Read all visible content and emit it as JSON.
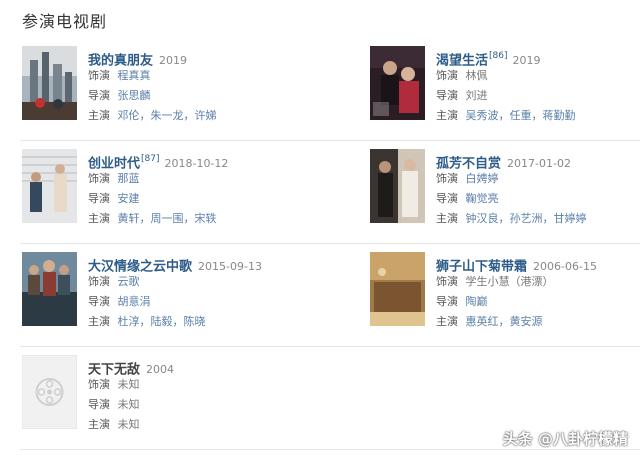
{
  "section_title": "参演电视剧",
  "items": [
    {
      "title": "我的真朋友",
      "ref": "",
      "date": "2019",
      "role_label": "饰演",
      "role": "程真真",
      "director_label": "导演",
      "director": "张思麟",
      "cast_label": "主演",
      "cast": [
        "邓伦",
        "朱一龙",
        "许娣"
      ]
    },
    {
      "title": "渴望生活",
      "ref": "[86]",
      "date": "2019",
      "role_label": "饰演",
      "role": "林佩",
      "director_label": "导演",
      "director": "刘进",
      "cast_label": "主演",
      "cast": [
        "吴秀波",
        "任重",
        "蒋勤勤"
      ]
    },
    {
      "title": "创业时代",
      "ref": "[87]",
      "date": "2018-10-12",
      "role_label": "饰演",
      "role": "那蓝",
      "director_label": "导演",
      "director": "安建",
      "cast_label": "主演",
      "cast": [
        "黄轩",
        "周一围",
        "宋轶"
      ]
    },
    {
      "title": "孤芳不自赏",
      "ref": "",
      "date": "2017-01-02",
      "role_label": "饰演",
      "role": "白娉婷",
      "director_label": "导演",
      "director": "鞠觉亮",
      "cast_label": "主演",
      "cast": [
        "钟汉良",
        "孙艺洲",
        "甘婷婷"
      ]
    },
    {
      "title": "大汉情缘之云中歌",
      "ref": "",
      "date": "2015-09-13",
      "role_label": "饰演",
      "role": "云歌",
      "director_label": "导演",
      "director": "胡意涓",
      "cast_label": "主演",
      "cast": [
        "杜淳",
        "陆毅",
        "陈晓"
      ]
    },
    {
      "title": "狮子山下菊带霜",
      "ref": "",
      "date": "2006-06-15",
      "role_label": "饰演",
      "role": "学生小慧（港漂）",
      "director_label": "导演",
      "director": "陶巅",
      "cast_label": "主演",
      "cast": [
        "惠英红",
        "黄安源"
      ]
    },
    {
      "title": "天下无敌",
      "ref": "",
      "date": "2004",
      "role_label": "饰演",
      "role": "未知",
      "director_label": "导演",
      "director": "未知",
      "cast_label": "主演",
      "cast": [
        "未知"
      ]
    }
  ],
  "watermark": "头条 @八卦柠檬精"
}
